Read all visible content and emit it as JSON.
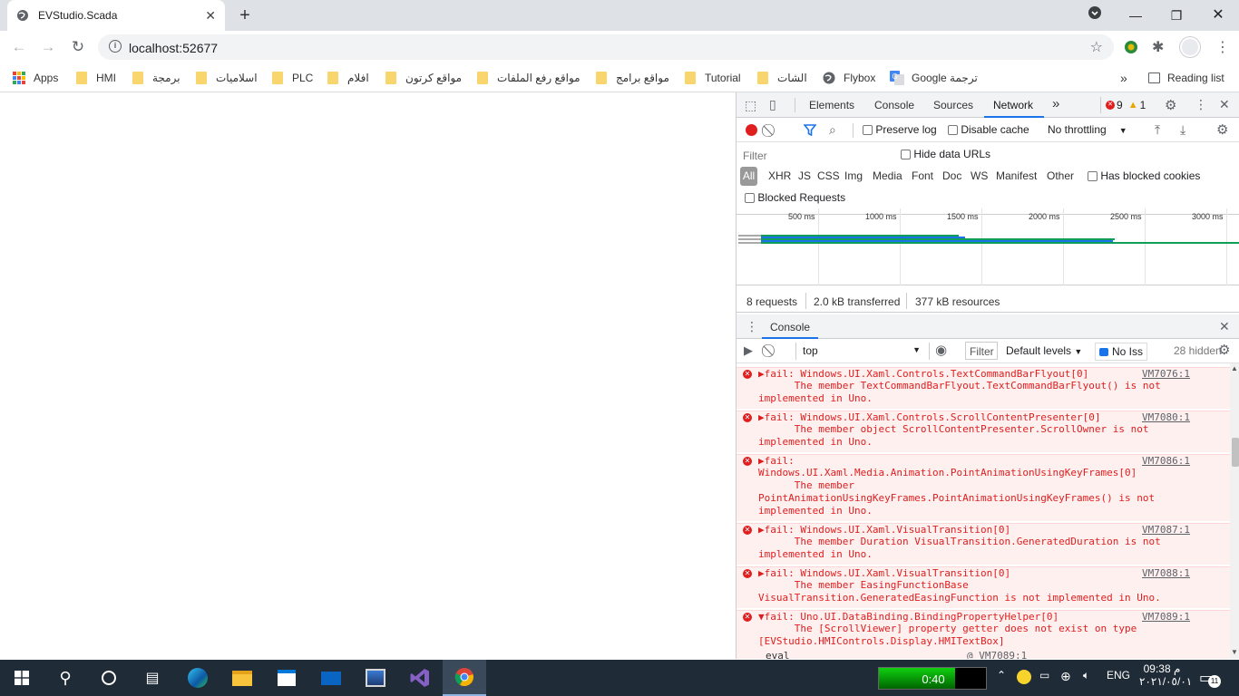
{
  "tab": {
    "title": "EVStudio.Scada"
  },
  "address": {
    "url": "localhost:52677"
  },
  "bookmarks": [
    {
      "label": "Apps",
      "type": "apps"
    },
    {
      "label": "HMI",
      "type": "folder"
    },
    {
      "label": "برمجة",
      "type": "folder"
    },
    {
      "label": "اسلاميات",
      "type": "folder"
    },
    {
      "label": "PLC",
      "type": "folder"
    },
    {
      "label": "افلام",
      "type": "folder"
    },
    {
      "label": "مواقع كرتون",
      "type": "folder"
    },
    {
      "label": "مواقع رفع الملفات",
      "type": "folder"
    },
    {
      "label": "مواقع برامج",
      "type": "folder"
    },
    {
      "label": "Tutorial",
      "type": "folder"
    },
    {
      "label": "الشات",
      "type": "folder"
    },
    {
      "label": "Flybox",
      "type": "site"
    },
    {
      "label": "Google ترجمة",
      "type": "site"
    }
  ],
  "bookmarks_more": "»",
  "reading_list": "Reading list",
  "devtools": {
    "tabs": [
      "Elements",
      "Console",
      "Sources",
      "Network"
    ],
    "active_tab": "Network",
    "more": "»",
    "errors": "9",
    "warnings": "1",
    "network": {
      "preserve_log": "Preserve log",
      "disable_cache": "Disable cache",
      "throttling": "No throttling",
      "filter_placeholder": "Filter",
      "hide_data_urls": "Hide data URLs",
      "types": [
        "All",
        "XHR",
        "JS",
        "CSS",
        "Img",
        "Media",
        "Font",
        "Doc",
        "WS",
        "Manifest",
        "Other"
      ],
      "has_blocked_cookies": "Has blocked cookies",
      "blocked_requests": "Blocked Requests",
      "ticks": [
        "500 ms",
        "1000 ms",
        "1500 ms",
        "2000 ms",
        "2500 ms",
        "3000 ms"
      ],
      "summary": {
        "requests": "8 requests",
        "transferred": "2.0 kB transferred",
        "resources": "377 kB resources"
      }
    },
    "console": {
      "drawer_tab": "Console",
      "context": "top",
      "filter_label": "Filter",
      "levels": "Default levels",
      "issues": "No Iss",
      "hidden": "28 hidden",
      "messages": [
        {
          "head": "▶fail: Windows.UI.Xaml.Controls.TextCommandBarFlyout[0]",
          "body": "      The member TextCommandBarFlyout.TextCommandBarFlyout() is not implemented in Uno.",
          "src": "VM7076:1"
        },
        {
          "head": "▶fail: Windows.UI.Xaml.Controls.ScrollContentPresenter[0]",
          "body": "      The member object ScrollContentPresenter.ScrollOwner is not implemented in Uno.",
          "src": "VM7080:1"
        },
        {
          "head": "▶fail:",
          "body": "Windows.UI.Xaml.Media.Animation.PointAnimationUsingKeyFrames[0]\n      The member PointAnimationUsingKeyFrames.PointAnimationUsingKeyFrames() is not implemented in Uno.",
          "src": "VM7086:1"
        },
        {
          "head": "▶fail: Windows.UI.Xaml.VisualTransition[0]",
          "body": "      The member Duration VisualTransition.GeneratedDuration is not implemented in Uno.",
          "src": "VM7087:1"
        },
        {
          "head": "▶fail: Windows.UI.Xaml.VisualTransition[0]",
          "body": "      The member EasingFunctionBase VisualTransition.GeneratedEasingFunction is not implemented in Uno.",
          "src": "VM7088:1"
        },
        {
          "head": "▼fail: Uno.UI.DataBinding.BindingPropertyHelper[0]",
          "body": "      The [ScrollViewer] property getter does not exist on type [EVStudio.HMIControls.Display.HMITextBox]",
          "src": "VM7089:1"
        }
      ],
      "last_line_left": "eval",
      "last_line_src": "@ VM7089:1"
    }
  },
  "taskbar": {
    "timer": "0:40",
    "timer_progress": 0.71,
    "lang": "ENG",
    "time": "09:38",
    "ampm": "م",
    "date": "٢٠٢١/٠٥/٠١",
    "notif_count": "11"
  }
}
